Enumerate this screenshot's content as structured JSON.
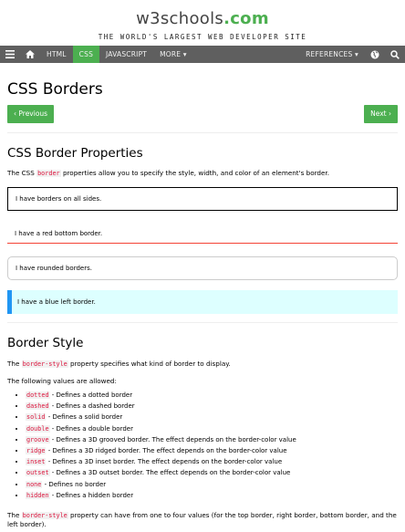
{
  "logo": {
    "w3": "w3schools",
    "com": ".com"
  },
  "tagline": "THE WORLD'S LARGEST WEB DEVELOPER SITE",
  "topnav": {
    "items": [
      "HTML",
      "CSS",
      "JAVASCRIPT",
      "MORE ▾"
    ],
    "references": "REFERENCES ▾"
  },
  "page": {
    "title": "CSS Borders",
    "prev": "‹ Previous",
    "next": "Next ›",
    "section1_title": "CSS Border Properties",
    "section1_pre": "The CSS ",
    "section1_code": "border",
    "section1_post": " properties allow you to specify the style, width, and color of an element's border.",
    "demo_all": "I have borders on all sides.",
    "demo_red": "I have a red bottom border.",
    "demo_round": "I have rounded borders.",
    "demo_blue": "I have a blue left border.",
    "section2_title": "Border Style",
    "section2_pre": "The ",
    "section2_code": "border-style",
    "section2_post": " property specifies what kind of border to display.",
    "allowed": "The following values are allowed:",
    "values": [
      {
        "code": "dotted",
        "text": " - Defines a dotted border"
      },
      {
        "code": "dashed",
        "text": " - Defines a dashed border"
      },
      {
        "code": "solid",
        "text": " - Defines a solid border"
      },
      {
        "code": "double",
        "text": " - Defines a double border"
      },
      {
        "code": "groove",
        "text": " - Defines a 3D grooved border. The effect depends on the border-color value"
      },
      {
        "code": "ridge",
        "text": " - Defines a 3D ridged border. The effect depends on the border-color value"
      },
      {
        "code": "inset",
        "text": " - Defines a 3D inset border. The effect depends on the border-color value"
      },
      {
        "code": "outset",
        "text": " - Defines a 3D outset border. The effect depends on the border-color value"
      },
      {
        "code": "none",
        "text": " - Defines no border"
      },
      {
        "code": "hidden",
        "text": " - Defines a hidden border"
      }
    ],
    "footer_pre": "The ",
    "footer_code": "border-style",
    "footer_post": " property can have from one to four values (for the top border, right border, bottom border, and the left border)."
  },
  "colors": {
    "green": "#4caf50",
    "nav": "#5f5f5f",
    "code": "#dc143c",
    "blue": "#2196f3",
    "red": "#f44336"
  }
}
